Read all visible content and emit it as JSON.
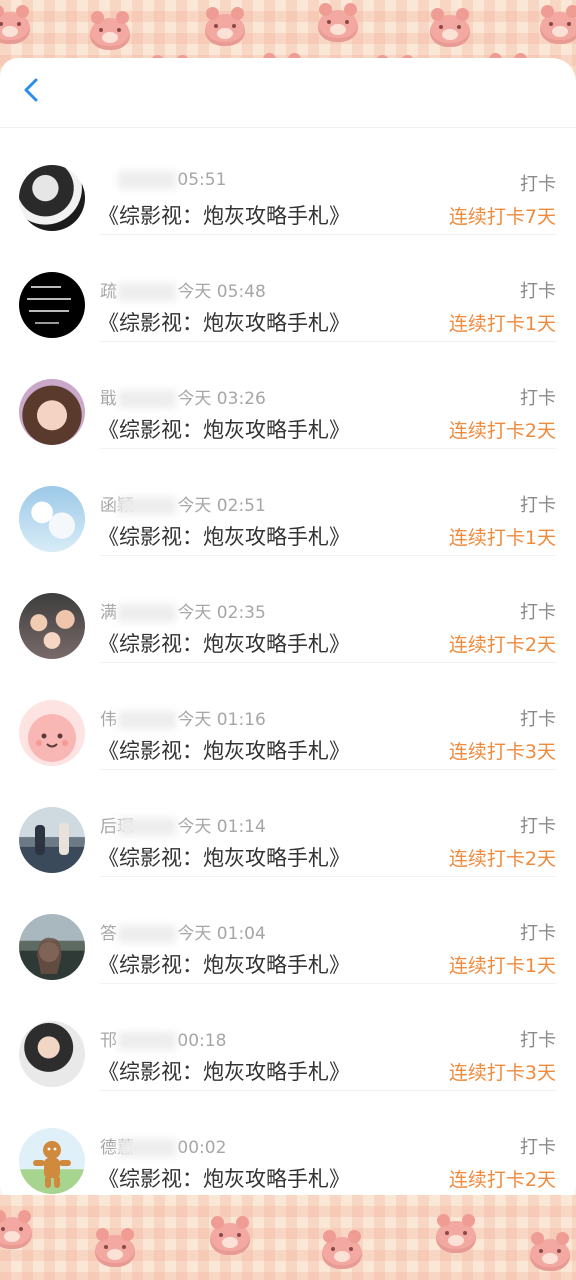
{
  "header": {
    "back_icon": "chevron-left-icon",
    "accent": "#2b8ff0"
  },
  "colors": {
    "streak": "#f08a3c",
    "name_time": "#a6a6a6",
    "book": "#333333"
  },
  "records": [
    {
      "name": "",
      "time": "05:51",
      "book": "《综影视：炮灰攻略手札》",
      "action": "打卡",
      "streak": "连续打卡7天",
      "avatar": "avatar-1"
    },
    {
      "name": "疏",
      "time": "今天 05:48",
      "book": "《综影视：炮灰攻略手札》",
      "action": "打卡",
      "streak": "连续打卡1天",
      "avatar": "avatar-2"
    },
    {
      "name": "戢",
      "time": "今天 03:26",
      "book": "《综影视：炮灰攻略手札》",
      "action": "打卡",
      "streak": "连续打卡2天",
      "avatar": "avatar-3"
    },
    {
      "name": "函颖",
      "time": "今天 02:51",
      "book": "《综影视：炮灰攻略手札》",
      "action": "打卡",
      "streak": "连续打卡1天",
      "avatar": "avatar-4"
    },
    {
      "name": "满",
      "time": "今天 02:35",
      "book": "《综影视：炮灰攻略手札》",
      "action": "打卡",
      "streak": "连续打卡2天",
      "avatar": "avatar-5"
    },
    {
      "name": "伟",
      "time": "今天 01:16",
      "book": "《综影视：炮灰攻略手札》",
      "action": "打卡",
      "streak": "连续打卡3天",
      "avatar": "avatar-6"
    },
    {
      "name": "后琛",
      "time": "今天 01:14",
      "book": "《综影视：炮灰攻略手札》",
      "action": "打卡",
      "streak": "连续打卡2天",
      "avatar": "avatar-7"
    },
    {
      "name": "答",
      "time": "今天 01:04",
      "book": "《综影视：炮灰攻略手札》",
      "action": "打卡",
      "streak": "连续打卡1天",
      "avatar": "avatar-8"
    },
    {
      "name": "邗",
      "time": "00:18",
      "book": "《综影视：炮灰攻略手札》",
      "action": "打卡",
      "streak": "连续打卡3天",
      "avatar": "avatar-9"
    },
    {
      "name": "德蕙",
      "time": "00:02",
      "book": "《综影视：炮灰攻略手札》",
      "action": "打卡",
      "streak": "连续打卡2天",
      "avatar": "avatar-10"
    }
  ]
}
